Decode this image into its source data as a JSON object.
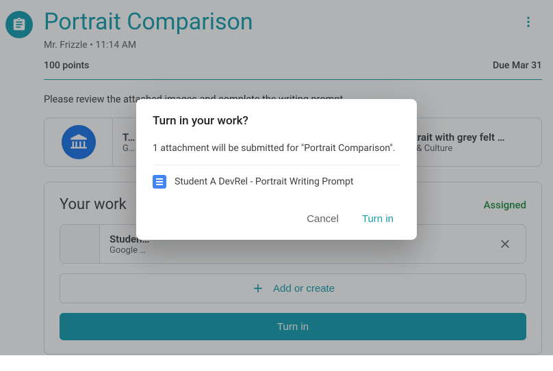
{
  "assignment": {
    "title": "Portrait Comparison",
    "teacher": "Mr. Frizzle",
    "posted_time": "11:14 AM",
    "meta_separator": " • ",
    "points": "100 points",
    "due": "Due Mar 31",
    "description": "Please review the attached images and complete the writing prompt."
  },
  "attachments": [
    {
      "title": "T…",
      "source": "G…"
    },
    {
      "title": "Portrait with grey felt …",
      "source": "Arts & Culture"
    }
  ],
  "your_work": {
    "header": "Your work",
    "status": "Assigned",
    "file_title": "Studen…",
    "file_type": "Google …",
    "add_create_label": "Add or create",
    "turn_in_label": "Turn in"
  },
  "dialog": {
    "title": "Turn in your work?",
    "body": "1 attachment will be submitted for \"Portrait Comparison\".",
    "attachment_name": "Student A DevRel - Portrait Writing Prompt",
    "cancel_label": "Cancel",
    "confirm_label": "Turn in"
  }
}
